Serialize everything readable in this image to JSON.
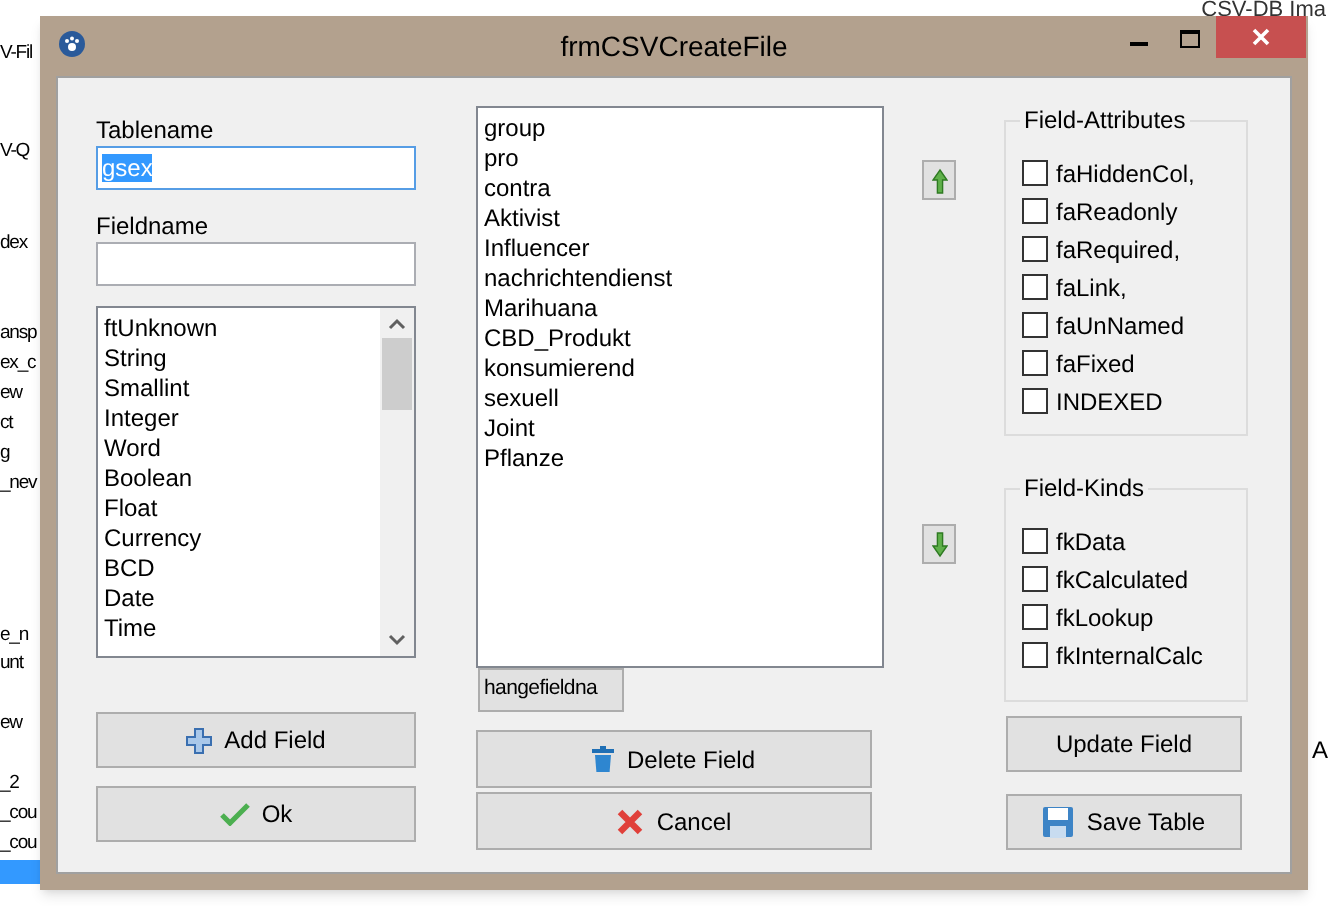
{
  "background": {
    "title": "CSV-DB Ima",
    "left_items": [
      {
        "text": "V-Fil"
      },
      {
        "text": "V-Q"
      },
      {
        "text": "dex"
      },
      {
        "text": "ansp"
      },
      {
        "text": "ex_c"
      },
      {
        "text": "ew"
      },
      {
        "text": "ct"
      },
      {
        "text": "g"
      },
      {
        "text": "_nev"
      },
      {
        "text": "e_n"
      },
      {
        "text": "unt"
      },
      {
        "text": "ew"
      },
      {
        "text": "_2"
      },
      {
        "text": "_cou"
      },
      {
        "text": "_cou"
      }
    ],
    "right_items": [
      {
        "text": "A"
      }
    ]
  },
  "window": {
    "title": "frmCSVCreateFile"
  },
  "tablename": {
    "label": "Tablename",
    "value": "gsex"
  },
  "fieldname": {
    "label": "Fieldname"
  },
  "field_types": [
    "ftUnknown",
    "String",
    "Smallint",
    "Integer",
    "Word",
    "Boolean",
    "Float",
    "Currency",
    "BCD",
    "Date",
    "Time"
  ],
  "fields": [
    "group",
    "pro",
    "contra",
    "Aktivist",
    "Influencer",
    "nachrichtendienst",
    "Marihuana",
    "CBD_Produkt",
    "konsumierend",
    "sexuell",
    "Joint",
    "Pflanze"
  ],
  "changefield_button": "hangefieldna",
  "field_attributes": {
    "title": "Field-Attributes",
    "items": [
      {
        "label": "faHiddenCol,",
        "checked": false
      },
      {
        "label": "faReadonly",
        "checked": false
      },
      {
        "label": "faRequired,",
        "checked": false
      },
      {
        "label": "faLink,",
        "checked": false
      },
      {
        "label": "faUnNamed",
        "checked": false
      },
      {
        "label": "faFixed",
        "checked": false
      },
      {
        "label": "INDEXED",
        "checked": false
      }
    ]
  },
  "field_kinds": {
    "title": "Field-Kinds",
    "items": [
      {
        "label": "fkData",
        "checked": false
      },
      {
        "label": "fkCalculated",
        "checked": false
      },
      {
        "label": "fkLookup",
        "checked": false
      },
      {
        "label": "fkInternalCalc",
        "checked": false
      }
    ]
  },
  "buttons": [
    {
      "kind": "add",
      "label": "Add Field"
    },
    {
      "kind": "ok",
      "label": "Ok"
    },
    {
      "kind": "delete",
      "label": "Delete Field"
    },
    {
      "kind": "cancel",
      "label": "Cancel"
    },
    {
      "kind": "update",
      "label": "Update Field"
    },
    {
      "kind": "save",
      "label": "Save Table"
    }
  ]
}
